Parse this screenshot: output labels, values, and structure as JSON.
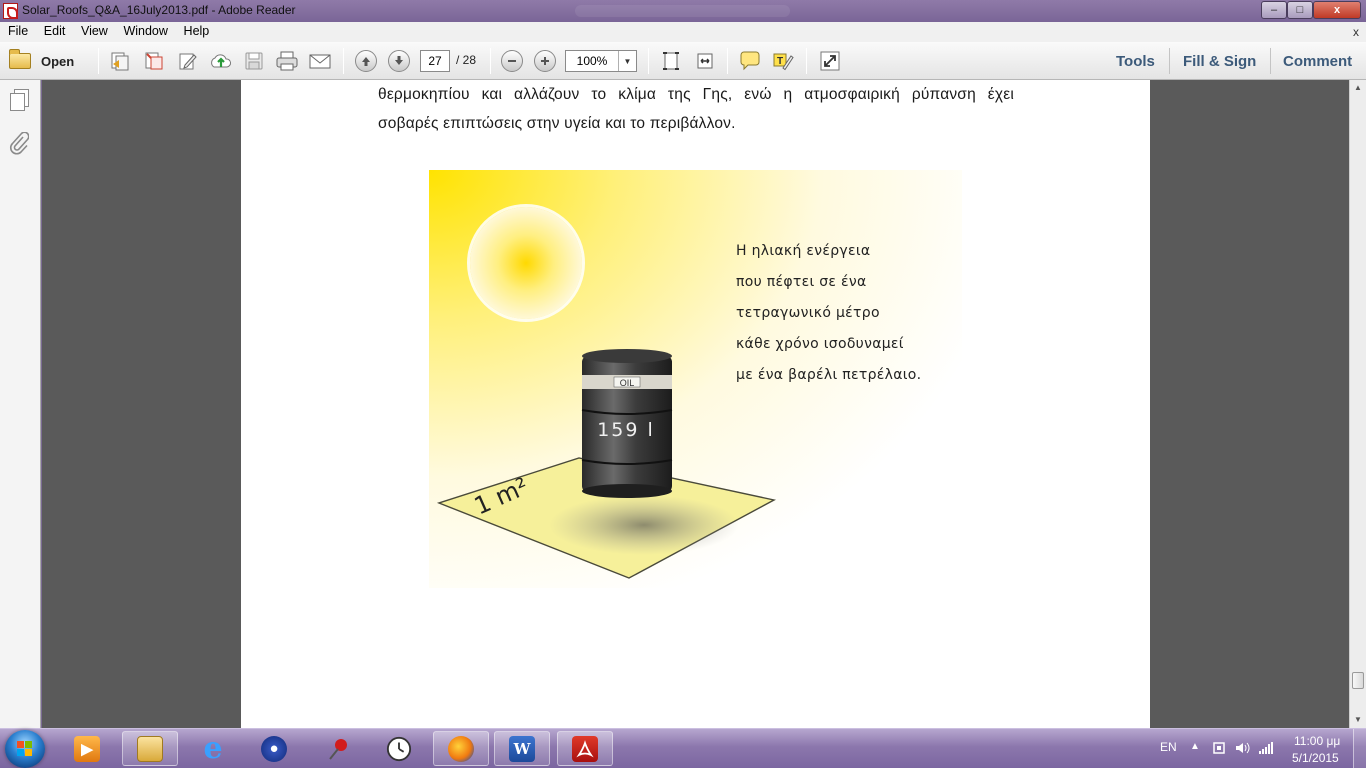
{
  "window": {
    "title": "Solar_Roofs_Q&A_16July2013.pdf - Adobe Reader",
    "controls": {
      "minimize": "–",
      "maximize": "□",
      "close": "x"
    }
  },
  "menu": {
    "items": [
      "File",
      "Edit",
      "View",
      "Window",
      "Help"
    ],
    "doc_close": "x"
  },
  "toolbar": {
    "open_label": "Open",
    "page_current": "27",
    "page_total": "/ 28",
    "zoom": "100%",
    "right_links": {
      "tools": "Tools",
      "fill_sign": "Fill & Sign",
      "comment": "Comment"
    }
  },
  "document": {
    "line1": "θερμοκηπίου και αλλάζουν το κλίμα της Γης, ενώ η ατμοσφαιρική ρύπανση έχει",
    "line2": "σοβαρές επιπτώσεις στην υγεία και το περιβάλλον.",
    "figure": {
      "caption_lines": [
        "Η ηλιακή ενέργεια",
        "που πέφτει σε ένα",
        "τετραγωνικό μέτρο",
        "κάθε χρόνο ισοδυναμεί",
        "με ένα βαρέλι πετρέλαιο."
      ],
      "barrel_label": "OIL",
      "barrel_volume": "159 l",
      "area_label": "1 m²"
    }
  },
  "taskbar": {
    "language": "EN",
    "time": "11:00 μμ",
    "date": "5/1/2015"
  },
  "colors": {
    "titlebar": "#8f7aa8",
    "taskbar": "#8c77ad",
    "doc_background": "#5a5a5a",
    "link_blue": "#3c5a7a"
  }
}
